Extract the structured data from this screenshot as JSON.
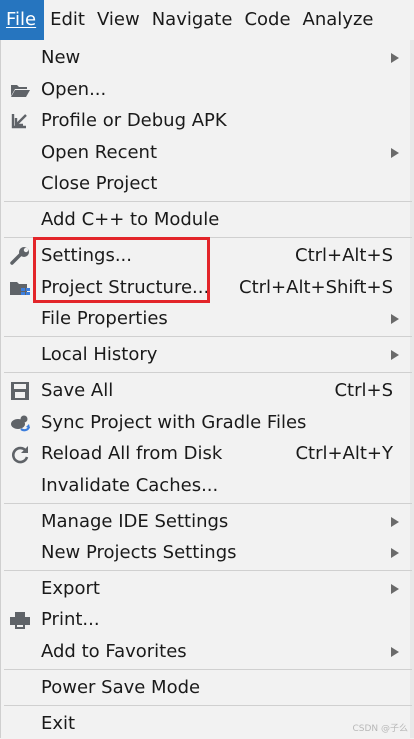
{
  "menubar": {
    "file": "File",
    "edit": "Edit",
    "view": "View",
    "navigate": "Navigate",
    "code": "Code",
    "analyze": "Analyze"
  },
  "menu": {
    "new": "New",
    "open": "Open...",
    "profile": "Profile or Debug APK",
    "open_recent": "Open Recent",
    "close_project": "Close Project",
    "add_cpp": "Add C++ to Module",
    "settings": "Settings...",
    "settings_shortcut": "Ctrl+Alt+S",
    "project_structure": "Project Structure...",
    "project_structure_shortcut": "Ctrl+Alt+Shift+S",
    "file_properties": "File Properties",
    "local_history": "Local History",
    "save_all": "Save All",
    "save_all_shortcut": "Ctrl+S",
    "sync_gradle": "Sync Project with Gradle Files",
    "reload": "Reload All from Disk",
    "reload_shortcut": "Ctrl+Alt+Y",
    "invalidate": "Invalidate Caches...",
    "manage_ide": "Manage IDE Settings",
    "new_projects_settings": "New Projects Settings",
    "export": "Export",
    "print": "Print...",
    "favorites": "Add to Favorites",
    "power_save": "Power Save Mode",
    "exit": "Exit"
  },
  "colors": {
    "active_menu": "#2675bf",
    "highlight_box": "#e3262a"
  },
  "watermark": "CSDN @子么"
}
